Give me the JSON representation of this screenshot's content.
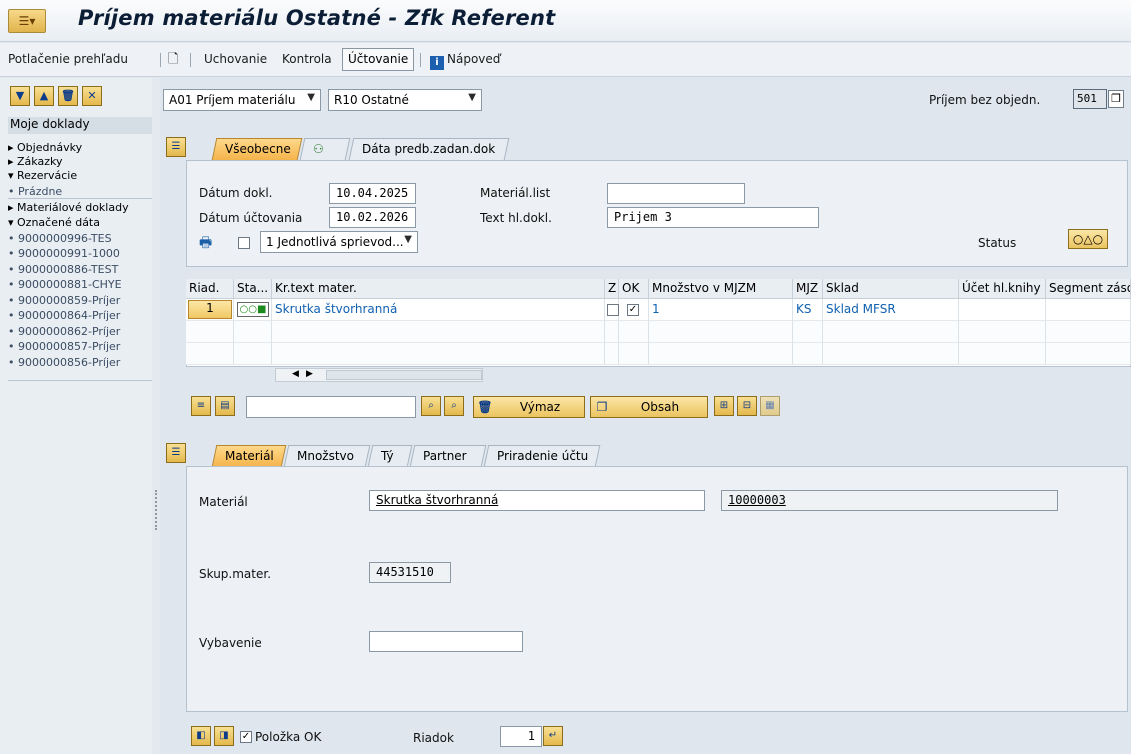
{
  "title": "Príjem materiálu Ostatné - Zfk Referent",
  "toolbar": {
    "overview_label": "Potlačenie prehľadu",
    "hold_label": "Uchovanie",
    "check_label": "Kontrola",
    "post_label": "Účtovanie",
    "help_label": "Nápoveď"
  },
  "nav": {
    "header": "Moje doklady",
    "items": [
      {
        "label": "▸ Objednávky"
      },
      {
        "label": "▸ Zákazky"
      },
      {
        "label": "▾ Rezervácie"
      },
      {
        "label": "   • Prázdne"
      },
      {
        "label": "▸ Materiálové doklady"
      },
      {
        "label": "▾ Označené dáta"
      },
      {
        "label": "   • 9000000996-TES"
      },
      {
        "label": "   • 9000000991-1000"
      },
      {
        "label": "   • 9000000886-TEST"
      },
      {
        "label": "   • 9000000881-CHYE"
      },
      {
        "label": "   • 9000000859-Príjer"
      },
      {
        "label": "   • 9000000864-Príjer"
      },
      {
        "label": "   • 9000000862-Príjer"
      },
      {
        "label": "   • 9000000857-Príjer"
      },
      {
        "label": "   • 9000000856-Príjer"
      }
    ]
  },
  "header": {
    "transaction": "A01 Príjem materiálu",
    "reference": "R10 Ostatné",
    "movement_label": "Príjem bez objedn.",
    "movement_type": "501"
  },
  "tabs_top": [
    {
      "label": "Všeobecne",
      "active": true
    },
    {
      "label": "⚇",
      "active": false
    },
    {
      "label": "Dáta predb.zadan.dok",
      "active": false
    }
  ],
  "general": {
    "doc_date_label": "Dátum dokl.",
    "doc_date": "10.04.2025",
    "post_date_label": "Dátum účtovania",
    "post_date": "10.02.2026",
    "slip_label": "Materiál.list",
    "slip": "",
    "header_text_label": "Text hl.dokl.",
    "header_text": "Prijem 3",
    "print_option": "1 Jednotlivá sprievod...",
    "status_label": "Status"
  },
  "grid": {
    "columns": [
      "Riad.",
      "Sta...",
      "Kr.text mater.",
      "Z",
      "OK",
      "Množstvo v MJZM",
      "MJZ",
      "Sklad",
      "Účet hl.knihy",
      "Segment zásob"
    ],
    "rows": [
      {
        "line": "1",
        "text": "Skrutka štvorhranná",
        "z": false,
        "ok": true,
        "qty": "1",
        "uom": "KS",
        "storage": "Sklad MFSR",
        "gl": "",
        "segment": ""
      }
    ]
  },
  "grid_toolbar": {
    "delete_label": "Výmaz",
    "content_label": "Obsah",
    "search_value": ""
  },
  "tabs_bottom": [
    {
      "label": "Materiál",
      "active": true
    },
    {
      "label": "Množstvo",
      "active": false
    },
    {
      "label": "Tý",
      "active": false
    },
    {
      "label": "Partner",
      "active": false
    },
    {
      "label": "Priradenie účtu",
      "active": false
    }
  ],
  "detail": {
    "material_label": "Materiál",
    "material_name": "Skrutka štvorhranná",
    "material_number": "10000003",
    "group_label": "Skup.mater.",
    "group": "44531510",
    "equipment_label": "Vybavenie",
    "equipment": ""
  },
  "footer": {
    "item_ok_label": "Položka OK",
    "item_ok": true,
    "line_label": "Riadok",
    "line_value": "1"
  }
}
